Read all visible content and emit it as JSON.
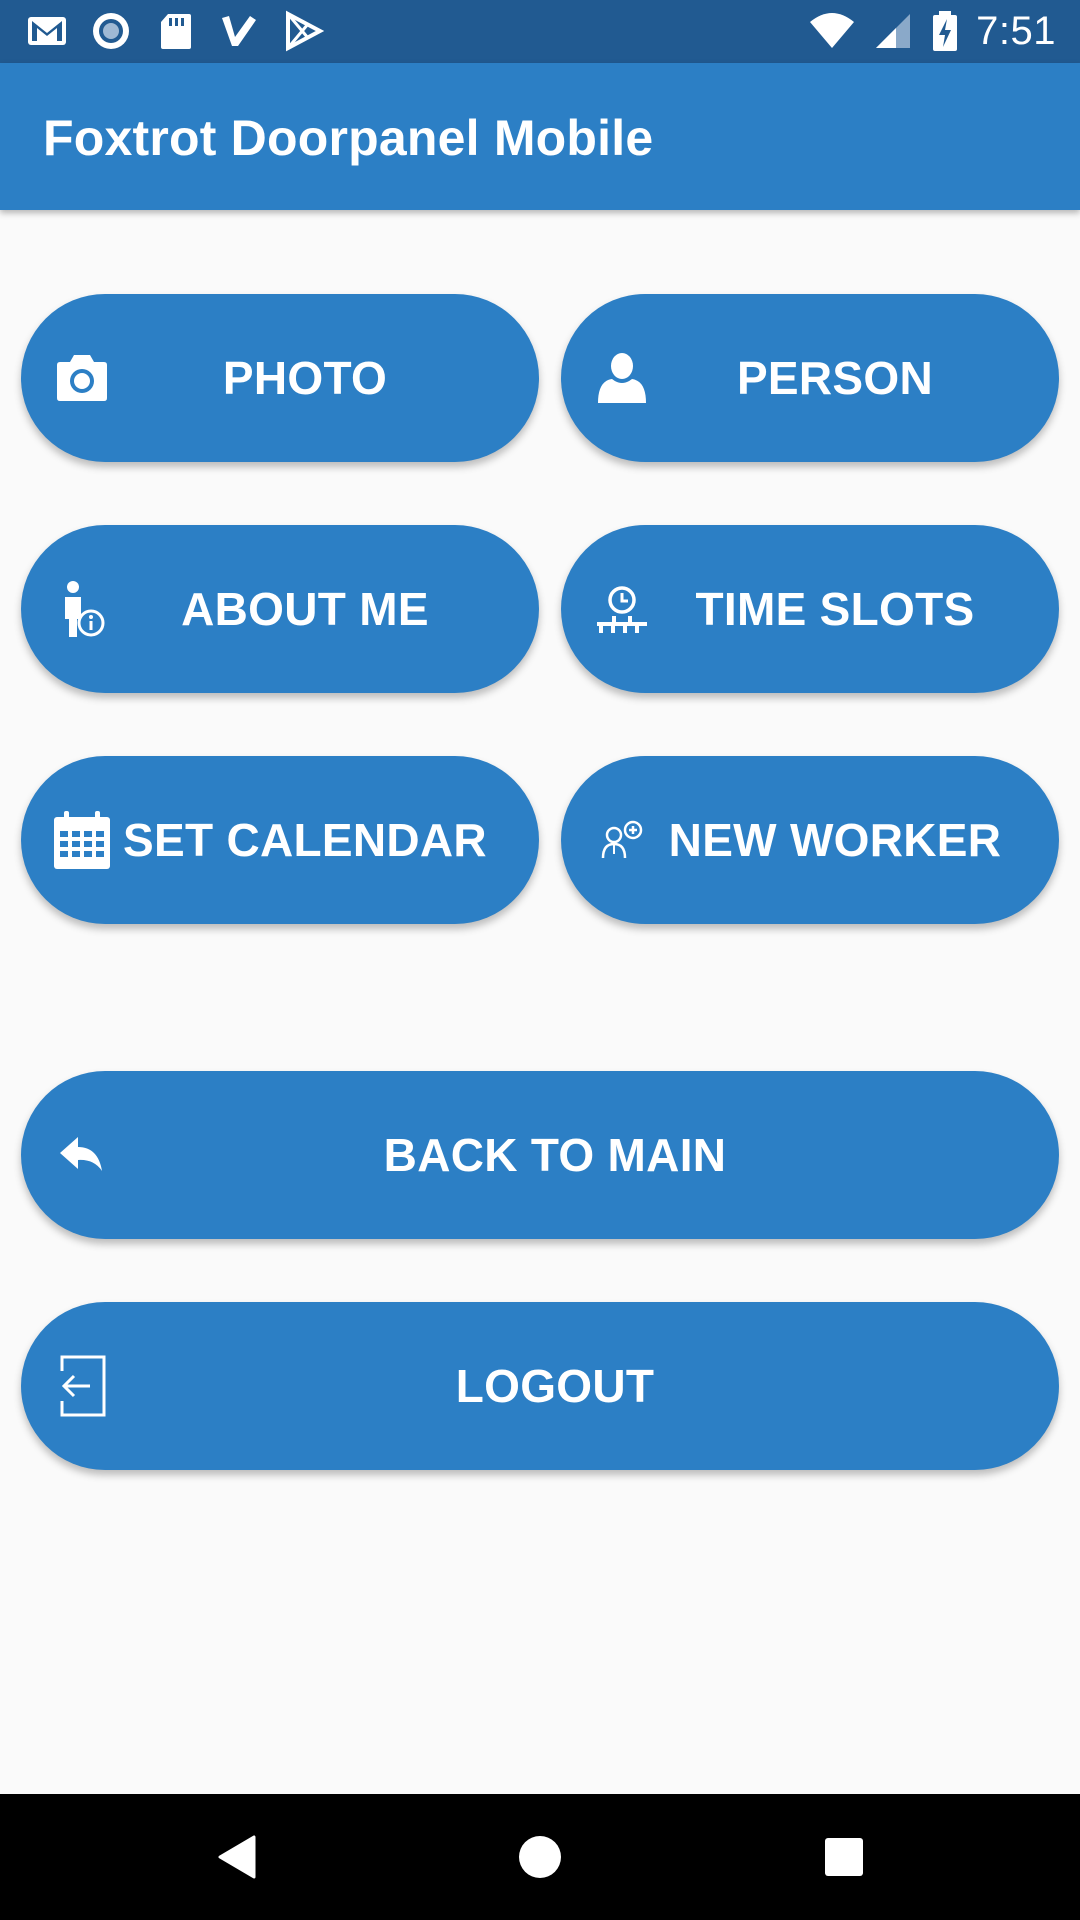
{
  "status_bar": {
    "left_icons": [
      "gmail-icon",
      "record-icon",
      "sd-card-icon",
      "check-icon",
      "play-store-icon"
    ],
    "right_icons": [
      "wifi-icon",
      "cellular-signal-icon",
      "battery-charging-icon"
    ],
    "time": "7:51"
  },
  "app_bar": {
    "title": "Foxtrot Doorpanel Mobile"
  },
  "menu": {
    "photo": {
      "label": "PHOTO",
      "icon": "camera-icon"
    },
    "person": {
      "label": "PERSON",
      "icon": "person-icon"
    },
    "about_me": {
      "label": "ABOUT ME",
      "icon": "person-info-icon"
    },
    "time_slots": {
      "label": "TIME SLOTS",
      "icon": "time-slots-icon"
    },
    "set_calendar": {
      "label": "SET CALENDAR",
      "icon": "calendar-icon"
    },
    "new_worker": {
      "label": "NEW WORKER",
      "icon": "add-worker-icon"
    },
    "back_to_main": {
      "label": "BACK TO MAIN",
      "icon": "reply-arrow-icon"
    },
    "logout": {
      "label": "LOGOUT",
      "icon": "logout-icon"
    }
  },
  "colors": {
    "status_bar": "#215a91",
    "app_bar": "#2c7fc5",
    "button": "#2c7fc5",
    "background": "#fafafa",
    "nav_bar": "#000000"
  },
  "nav_bar": {
    "buttons": [
      "back-icon",
      "home-icon",
      "recents-icon"
    ]
  }
}
